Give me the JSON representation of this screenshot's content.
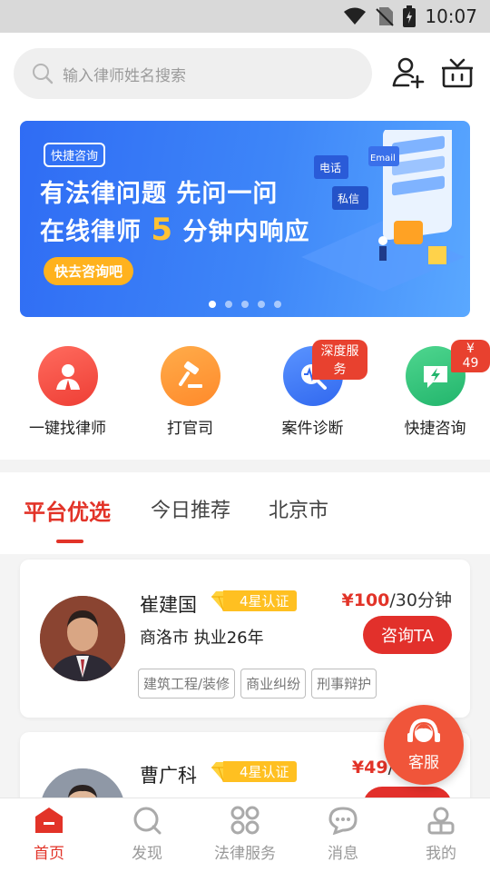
{
  "status": {
    "time": "10:07"
  },
  "search": {
    "placeholder": "输入律师姓名搜索"
  },
  "banner": {
    "tag": "快捷咨询",
    "line1": "有法律问题 先问一问",
    "line2_pre": "在线律师 ",
    "line2_num": "5",
    "line2_post": " 分钟内响应",
    "cta": "快去咨询吧",
    "bubble1": "电话",
    "bubble2": "私信",
    "bubble3": "Email",
    "dots": 5,
    "active_dot": 0
  },
  "features": [
    {
      "label": "一键找律师",
      "icon": "lawyer-person-icon",
      "color": "#f2544a"
    },
    {
      "label": "打官司",
      "icon": "gavel-icon",
      "color": "#ff8d32"
    },
    {
      "label": "案件诊断",
      "icon": "diagnosis-icon",
      "color": "#3d7af5",
      "badge": "深度服务"
    },
    {
      "label": "快捷咨询",
      "icon": "lightning-chat-icon",
      "color": "#2ec27a",
      "badge": "¥ 49"
    }
  ],
  "tabs": {
    "t0": "平台优选",
    "t1": "今日推荐",
    "t2": "北京市"
  },
  "lawyers": [
    {
      "name": "崔建国",
      "cert": "4星认证",
      "price_amount": "¥100",
      "price_unit": "/30分钟",
      "consult": "咨询TA",
      "meta": "商洛市  执业26年",
      "tags": [
        "建筑工程/装修",
        "商业纠纷",
        "刑事辩护"
      ]
    },
    {
      "name": "曹广科",
      "cert": "4星认证",
      "price_amount": "¥49",
      "price_unit": "/"
    }
  ],
  "kefu": {
    "label": "客服"
  },
  "tabbar": [
    {
      "label": "首页"
    },
    {
      "label": "发现"
    },
    {
      "label": "法律服务"
    },
    {
      "label": "消息"
    },
    {
      "label": "我的"
    }
  ],
  "colors": {
    "accent": "#e23328",
    "gold": "#ffc021"
  }
}
